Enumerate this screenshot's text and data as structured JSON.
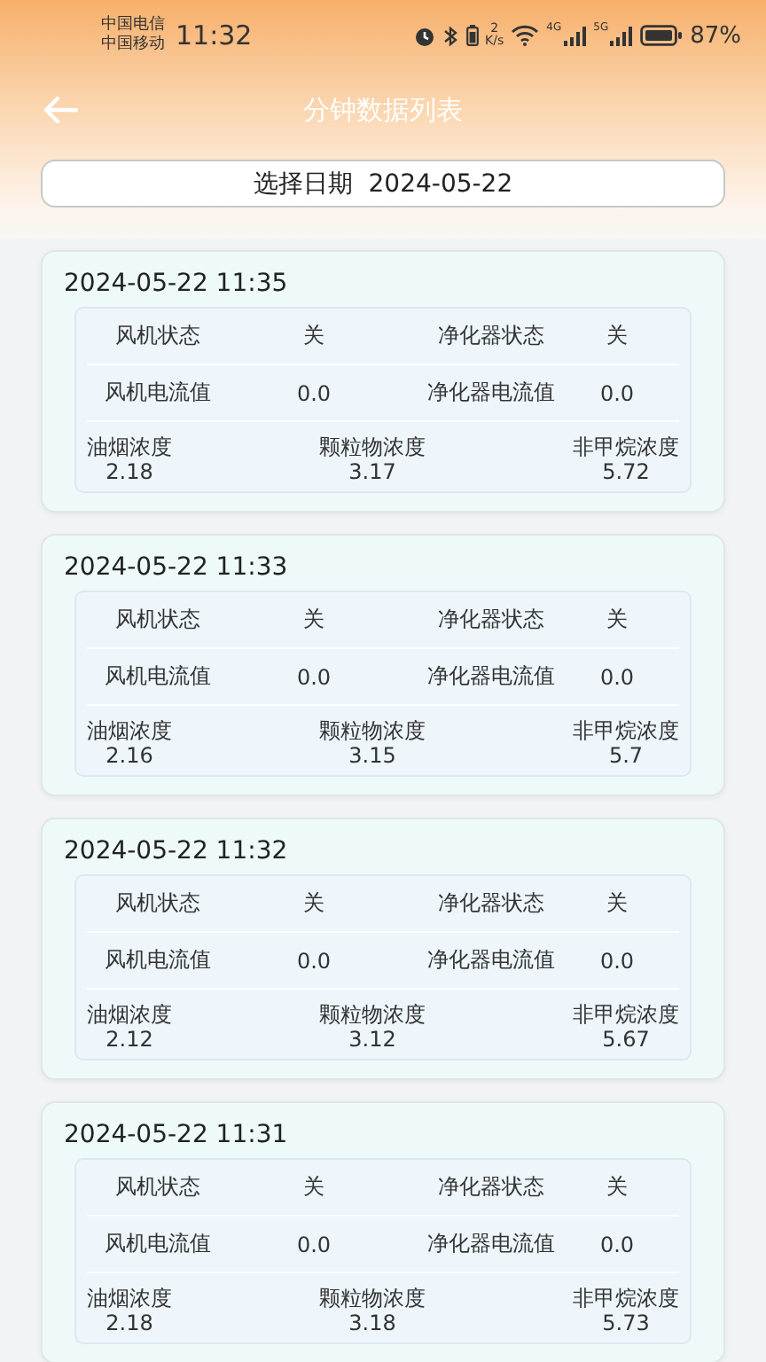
{
  "status_bar": {
    "carriers": [
      "中国电信",
      "中国移动"
    ],
    "time": "11:32",
    "speed_value": "2",
    "speed_unit": "K/s",
    "networks": [
      "4G",
      "5G"
    ],
    "battery": "87%"
  },
  "header": {
    "title": "分钟数据列表"
  },
  "date_picker": {
    "label": "选择日期",
    "value": "2024-05-22"
  },
  "records": [
    {
      "time": "2024-05-22 11:35",
      "fan_state_label": "风机状态",
      "fan_state": "关",
      "purifier_state_label": "净化器状态",
      "purifier_state": "关",
      "fan_current_label": "风机电流值",
      "fan_current": "0.0",
      "purifier_current_label": "净化器电流值",
      "purifier_current": "0.0",
      "readings": [
        {
          "label": "油烟浓度",
          "value": "2.18"
        },
        {
          "label": "颗粒物浓度",
          "value": "3.17"
        },
        {
          "label": "非甲烷浓度",
          "value": "5.72"
        }
      ]
    },
    {
      "time": "2024-05-22 11:33",
      "fan_state_label": "风机状态",
      "fan_state": "关",
      "purifier_state_label": "净化器状态",
      "purifier_state": "关",
      "fan_current_label": "风机电流值",
      "fan_current": "0.0",
      "purifier_current_label": "净化器电流值",
      "purifier_current": "0.0",
      "readings": [
        {
          "label": "油烟浓度",
          "value": "2.16"
        },
        {
          "label": "颗粒物浓度",
          "value": "3.15"
        },
        {
          "label": "非甲烷浓度",
          "value": "5.7"
        }
      ]
    },
    {
      "time": "2024-05-22 11:32",
      "fan_state_label": "风机状态",
      "fan_state": "关",
      "purifier_state_label": "净化器状态",
      "purifier_state": "关",
      "fan_current_label": "风机电流值",
      "fan_current": "0.0",
      "purifier_current_label": "净化器电流值",
      "purifier_current": "0.0",
      "readings": [
        {
          "label": "油烟浓度",
          "value": "2.12"
        },
        {
          "label": "颗粒物浓度",
          "value": "3.12"
        },
        {
          "label": "非甲烷浓度",
          "value": "5.67"
        }
      ]
    },
    {
      "time": "2024-05-22 11:31",
      "fan_state_label": "风机状态",
      "fan_state": "关",
      "purifier_state_label": "净化器状态",
      "purifier_state": "关",
      "fan_current_label": "风机电流值",
      "fan_current": "0.0",
      "purifier_current_label": "净化器电流值",
      "purifier_current": "0.0",
      "readings": [
        {
          "label": "油烟浓度",
          "value": "2.18"
        },
        {
          "label": "颗粒物浓度",
          "value": "3.18"
        },
        {
          "label": "非甲烷浓度",
          "value": "5.73"
        }
      ]
    }
  ]
}
